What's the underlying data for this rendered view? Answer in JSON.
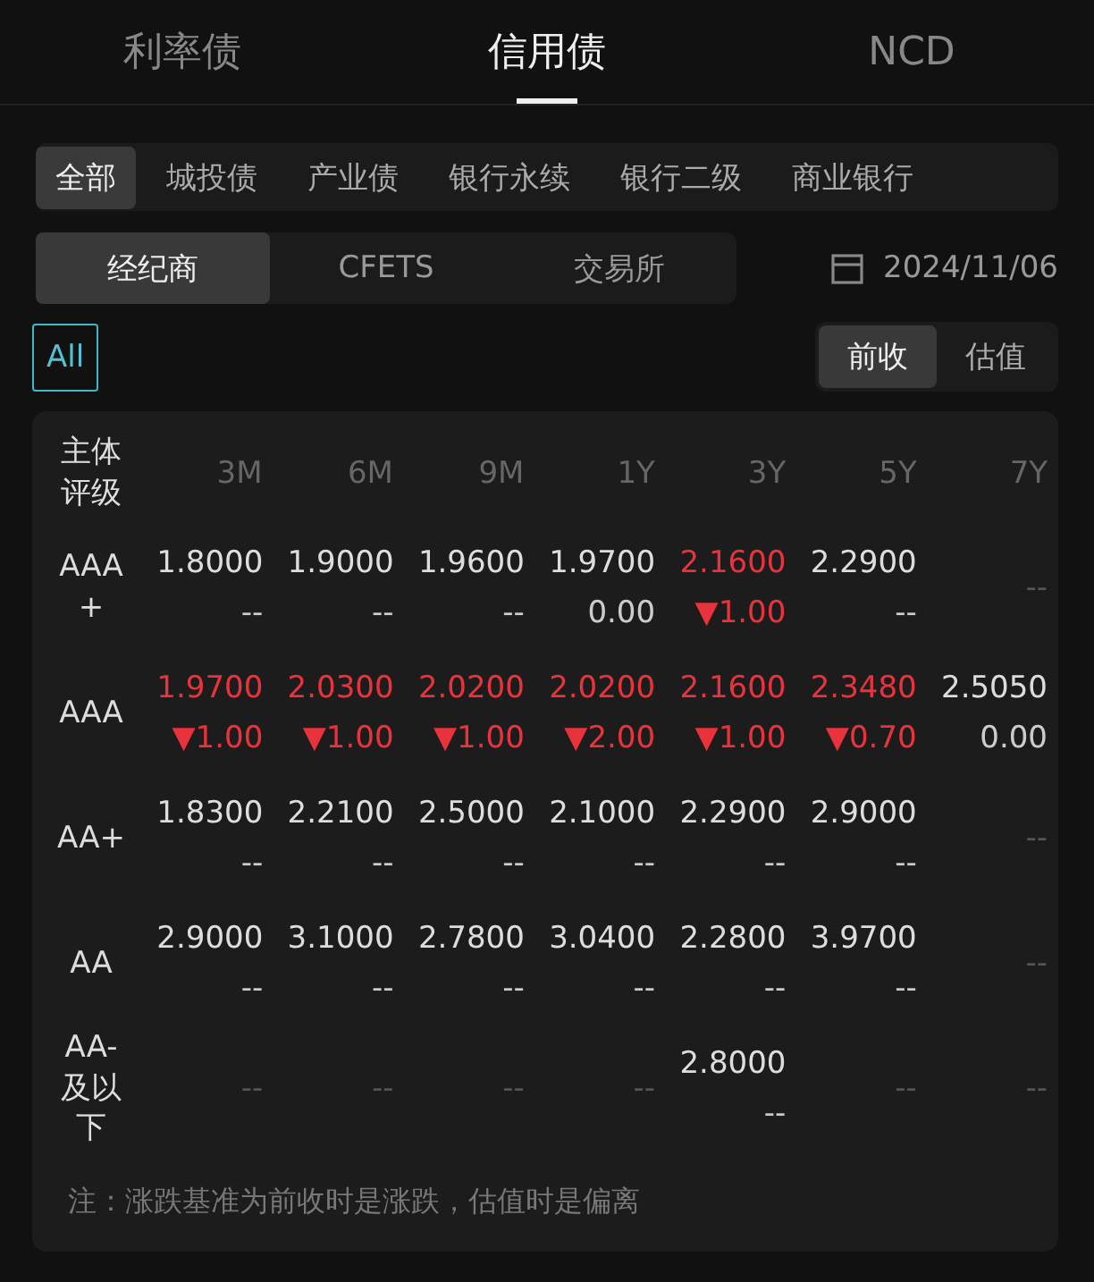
{
  "tabs": [
    {
      "label": "利率债",
      "selected": false
    },
    {
      "label": "信用债",
      "selected": true
    },
    {
      "label": "NCD",
      "selected": false
    }
  ],
  "categories": [
    {
      "label": "全部",
      "selected": true
    },
    {
      "label": "城投债",
      "selected": false
    },
    {
      "label": "产业债",
      "selected": false
    },
    {
      "label": "银行永续",
      "selected": false
    },
    {
      "label": "银行二级",
      "selected": false
    },
    {
      "label": "商业银行",
      "selected": false
    }
  ],
  "sources": [
    {
      "label": "经纪商",
      "selected": true
    },
    {
      "label": "CFETS",
      "selected": false
    },
    {
      "label": "交易所",
      "selected": false
    }
  ],
  "date": "2024/11/06",
  "all_filter": {
    "label": "All",
    "selected": true
  },
  "basis": [
    {
      "label": "前收",
      "selected": true
    },
    {
      "label": "估值",
      "selected": false
    }
  ],
  "table": {
    "rating_header": "主体评级",
    "columns": [
      "3M",
      "6M",
      "9M",
      "1Y",
      "3Y",
      "5Y",
      "7Y"
    ],
    "rows": [
      {
        "rating": "AAA+",
        "cells": [
          {
            "kind": "quote",
            "rate": "1.8000",
            "change": "--",
            "down": false
          },
          {
            "kind": "quote",
            "rate": "1.9000",
            "change": "--",
            "down": false
          },
          {
            "kind": "quote",
            "rate": "1.9600",
            "change": "--",
            "down": false
          },
          {
            "kind": "quote",
            "rate": "1.9700",
            "change": "0.00",
            "down": false
          },
          {
            "kind": "quote",
            "rate": "2.1600",
            "change": "▼1.00",
            "down": true
          },
          {
            "kind": "quote",
            "rate": "2.2900",
            "change": "--",
            "down": false
          },
          {
            "kind": "empty",
            "text": "--"
          }
        ]
      },
      {
        "rating": "AAA",
        "cells": [
          {
            "kind": "quote",
            "rate": "1.9700",
            "change": "▼1.00",
            "down": true
          },
          {
            "kind": "quote",
            "rate": "2.0300",
            "change": "▼1.00",
            "down": true
          },
          {
            "kind": "quote",
            "rate": "2.0200",
            "change": "▼1.00",
            "down": true
          },
          {
            "kind": "quote",
            "rate": "2.0200",
            "change": "▼2.00",
            "down": true
          },
          {
            "kind": "quote",
            "rate": "2.1600",
            "change": "▼1.00",
            "down": true
          },
          {
            "kind": "quote",
            "rate": "2.3480",
            "change": "▼0.70",
            "down": true
          },
          {
            "kind": "quote",
            "rate": "2.5050",
            "change": "0.00",
            "down": false
          }
        ]
      },
      {
        "rating": "AA+",
        "cells": [
          {
            "kind": "quote",
            "rate": "1.8300",
            "change": "--",
            "down": false
          },
          {
            "kind": "quote",
            "rate": "2.2100",
            "change": "--",
            "down": false
          },
          {
            "kind": "quote",
            "rate": "2.5000",
            "change": "--",
            "down": false
          },
          {
            "kind": "quote",
            "rate": "2.1000",
            "change": "--",
            "down": false
          },
          {
            "kind": "quote",
            "rate": "2.2900",
            "change": "--",
            "down": false
          },
          {
            "kind": "quote",
            "rate": "2.9000",
            "change": "--",
            "down": false
          },
          {
            "kind": "empty",
            "text": "--"
          }
        ]
      },
      {
        "rating": "AA",
        "cells": [
          {
            "kind": "quote",
            "rate": "2.9000",
            "change": "--",
            "down": false
          },
          {
            "kind": "quote",
            "rate": "3.1000",
            "change": "--",
            "down": false
          },
          {
            "kind": "quote",
            "rate": "2.7800",
            "change": "--",
            "down": false
          },
          {
            "kind": "quote",
            "rate": "3.0400",
            "change": "--",
            "down": false
          },
          {
            "kind": "quote",
            "rate": "2.2800",
            "change": "--",
            "down": false
          },
          {
            "kind": "quote",
            "rate": "3.9700",
            "change": "--",
            "down": false
          },
          {
            "kind": "empty",
            "text": "--"
          }
        ]
      },
      {
        "rating": "AA-及以下",
        "cells": [
          {
            "kind": "empty",
            "text": "--"
          },
          {
            "kind": "empty",
            "text": "--"
          },
          {
            "kind": "empty",
            "text": "--"
          },
          {
            "kind": "empty",
            "text": "--"
          },
          {
            "kind": "quote",
            "rate": "2.8000",
            "change": "--",
            "down": false
          },
          {
            "kind": "empty",
            "text": "--"
          },
          {
            "kind": "empty",
            "text": "--"
          }
        ]
      }
    ]
  },
  "note": "注：涨跌基准为前收时是涨跌，估值时是偏离"
}
